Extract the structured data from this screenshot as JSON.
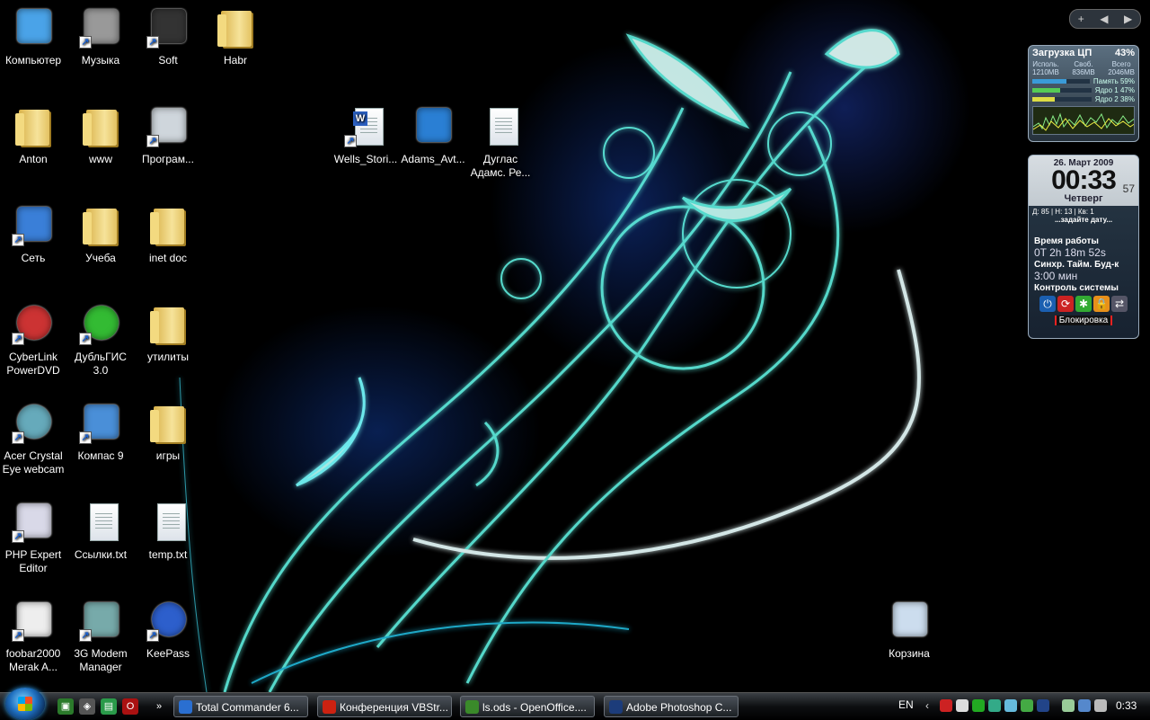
{
  "desktop": {
    "icons": [
      {
        "label": "Компьютер",
        "icon": "computer-icon"
      },
      {
        "label": "Музыка",
        "icon": "speaker-icon"
      },
      {
        "label": "Soft",
        "icon": "device-icon"
      },
      {
        "label": "Habr",
        "icon": "folder-icon"
      },
      {
        "label": "Anton",
        "icon": "user-folder-icon"
      },
      {
        "label": "www",
        "icon": "folder-icon"
      },
      {
        "label": "Програм...",
        "icon": "programs-icon"
      },
      {
        "label": "Wells_Stori...",
        "icon": "word-doc-icon"
      },
      {
        "label": "Adams_Avt...",
        "icon": "ebook-icon"
      },
      {
        "label": "Дуглас Адамс. Ре...",
        "icon": "text-doc-icon"
      },
      {
        "label": "Сеть",
        "icon": "network-icon"
      },
      {
        "label": "Учеба",
        "icon": "folder-icon"
      },
      {
        "label": "inet doc",
        "icon": "folder-icon"
      },
      {
        "label": "CyberLink PowerDVD",
        "icon": "dvd-icon"
      },
      {
        "label": "ДубльГИС 3.0",
        "icon": "dublgis-icon"
      },
      {
        "label": "утилиты",
        "icon": "folder-icon"
      },
      {
        "label": "Acer Crystal Eye webcam",
        "icon": "webcam-icon"
      },
      {
        "label": "Компас 9",
        "icon": "kompas-icon"
      },
      {
        "label": "игры",
        "icon": "folder-icon"
      },
      {
        "label": "PHP Expert Editor",
        "icon": "php-icon"
      },
      {
        "label": "Ссылки.txt",
        "icon": "text-doc-icon"
      },
      {
        "label": "temp.txt",
        "icon": "text-doc-icon"
      },
      {
        "label": "foobar2000 Merak A...",
        "icon": "foobar-icon"
      },
      {
        "label": "3G Modem Manager",
        "icon": "modem-icon"
      },
      {
        "label": "KeePass",
        "icon": "keepass-icon"
      },
      {
        "label": "Корзина",
        "icon": "recycle-bin-icon"
      }
    ]
  },
  "sidebar": {
    "add": "+",
    "prev": "◀",
    "next": "▶"
  },
  "cpu_gadget": {
    "title": "Загрузка ЦП",
    "percent": "43%",
    "col1_title": "Исполь.",
    "col1_val": "1210MB",
    "col2_title": "Своб.",
    "col2_val": "836MB",
    "col3_title": "Всего",
    "col3_val": "2046MB",
    "memory_label": "Память",
    "memory_pct": "59%",
    "memory_level": 0.59,
    "core1_label": "Ядро 1",
    "core1_pct": "47%",
    "core1_level": 0.47,
    "core2_label": "Ядро 2",
    "core2_pct": "38%",
    "core2_level": 0.38
  },
  "clock_gadget": {
    "date": "26. Март 2009",
    "time": "00:33",
    "seconds": "57",
    "weekday": "Четверг",
    "week_info": "Д: 85 |    Н: 13 |    Кв: 1",
    "date_prompt": "...задайте дату...",
    "uptime_title": "Время работы",
    "uptime": "0T 2h 18m 52s",
    "sync_title": "Синхр.  Тайм.  Буд-к",
    "timer": "3:00 мин",
    "control_title": "Контроль системы",
    "lock": "Блокировка"
  },
  "taskbar": {
    "chevron": "»",
    "tasks": [
      {
        "label": "Total Commander 6...",
        "icon": "total-commander-icon",
        "color": "#2a6fd1"
      },
      {
        "label": "Конференция VBStr...",
        "icon": "opera-icon",
        "color": "#c21"
      },
      {
        "label": "ls.ods - OpenOffice....",
        "icon": "openoffice-icon",
        "color": "#3a8a2a"
      },
      {
        "label": "Adobe Photoshop C...",
        "icon": "photoshop-icon",
        "color": "#1c3c7a"
      }
    ],
    "lang": "EN",
    "clock": "0:33"
  }
}
